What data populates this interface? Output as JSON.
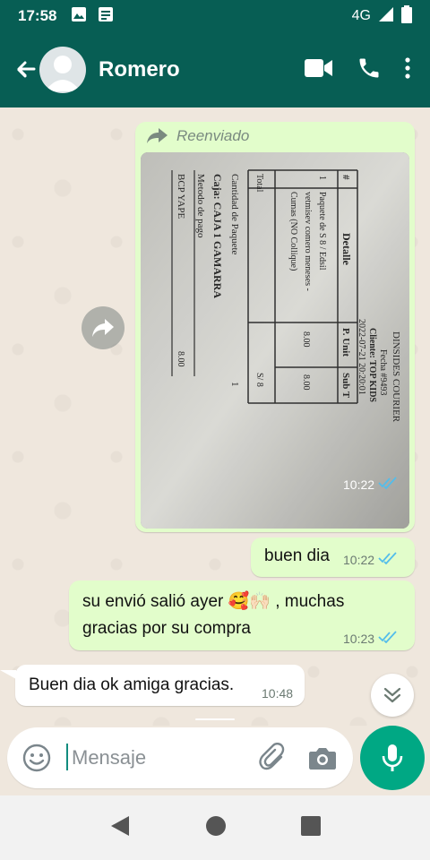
{
  "status_bar": {
    "time": "17:58",
    "network": "4G"
  },
  "header": {
    "contact_name": "Romero"
  },
  "messages": [
    {
      "type": "image",
      "direction": "out",
      "label": "Reenviado",
      "time": "10:22",
      "status": "read"
    },
    {
      "type": "text",
      "direction": "out",
      "text": "buen dia",
      "time": "10:22",
      "status": "read"
    },
    {
      "type": "text",
      "direction": "out",
      "text_line1": "su envió salió ayer 🥰🙌🏻 , muchas",
      "text_line2": "gracias por su compra",
      "time": "10:23",
      "status": "read"
    },
    {
      "type": "text",
      "direction": "in",
      "text": "Buen dia ok amiga gracias.",
      "time": "10:48"
    }
  ],
  "photo_text": {
    "company": "DINSIDES COURIER",
    "fecha": "Fecha #9493",
    "cliente": "Cliente: TOP KIDS",
    "date": "2022-07-21 20:20:01",
    "col_hash": "#",
    "col_detalle": "Detalle",
    "col_punit": "P. Unit",
    "col_subt": "Sub T",
    "row1_num": "1",
    "row1_line1": "Paquete de S 8 / Edsil",
    "row1_line2": "vetmisev comero meneses -",
    "row1_line3": "Cumas (NO Collique)",
    "row1_price": "8.00",
    "row1_subt": "8.00",
    "total_label": "Total",
    "total_value": "S/ 8",
    "cantidad": "Cantidad de Paquete",
    "cantidad_value": "1",
    "caja": "Caja: CAJA 1 GAMARRA",
    "metodo": "Metodo de pago",
    "bcp": "BCP YAPE",
    "bcp_value": "8.00"
  },
  "input": {
    "placeholder": "Mensaje"
  },
  "colors": {
    "header": "#075e54",
    "outgoing": "#e2fdcb",
    "incoming": "#ffffff",
    "accent": "#00a884",
    "read_ticks": "#53bdeb"
  }
}
